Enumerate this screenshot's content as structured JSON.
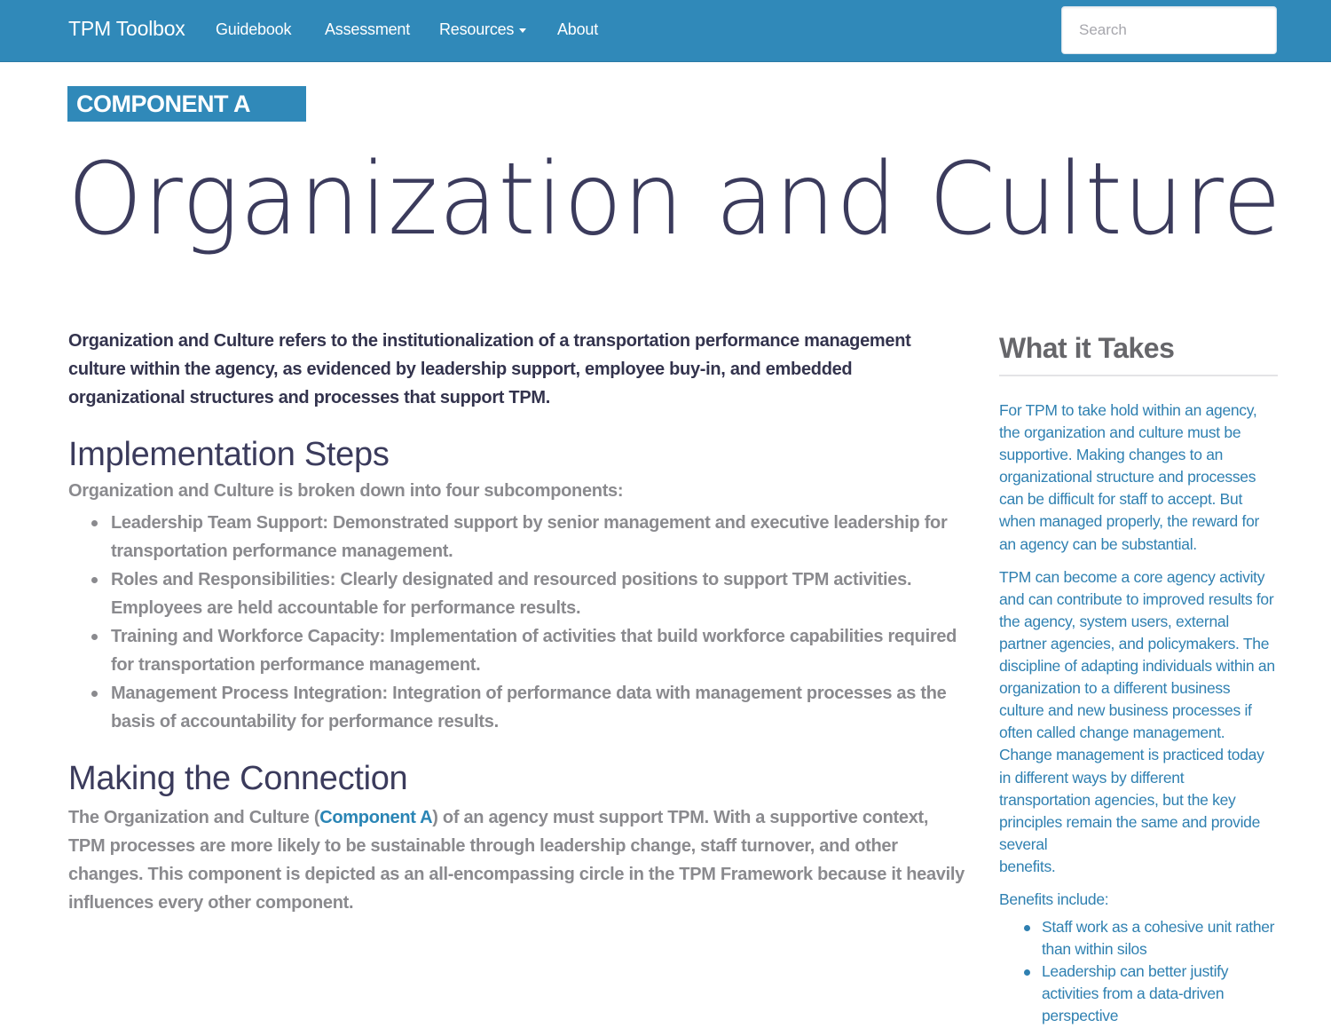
{
  "navbar": {
    "brand": "TPM Toolbox",
    "links": [
      {
        "label": "Guidebook"
      },
      {
        "label": "Assessment"
      },
      {
        "label": "Resources",
        "has_dropdown": true
      },
      {
        "label": "About"
      }
    ],
    "search_placeholder": "Search",
    "search_value": ""
  },
  "header": {
    "component_label": "COMPONENT A",
    "title": "Organization and Culture"
  },
  "main": {
    "intro": "Organization and Culture refers to the institutionalization of a transportation performance management culture within the agency, as evidenced by leadership support, employee buy-in, and embedded organizational structures and processes that support TPM.",
    "implementation": {
      "heading": "Implementation Steps",
      "intro": "Organization and Culture is broken down into four subcomponents:",
      "items": [
        "Leadership Team Support: Demonstrated support by senior management and executive leadership for transportation performance management.",
        "Roles and Responsibilities: Clearly designated and resourced positions to support TPM activities. Employees are held accountable for performance results.",
        "Training and Workforce Capacity: Implementation of activities that build workforce capabilities required for transportation performance management.",
        "Management Process Integration: Integration of performance data with management processes as the basis of accountability for performance results."
      ]
    },
    "connection": {
      "heading": "Making the Connection",
      "text_before": "The Organization and Culture (",
      "link": "Component A",
      "text_after": ") of an agency must support TPM. With a supportive context, TPM processes are more likely to be sustainable through leadership change, staff turnover, and other changes. This component is depicted as an all-encompassing circle in the TPM Framework because it heavily influences every other component."
    }
  },
  "sidebar": {
    "title": "What it Takes",
    "paragraph1": "For TPM to take hold within an agency, the organization and culture must be supportive. Making changes to an organizational structure and processes can be difficult for staff to accept. But when managed properly, the reward for an agency can be substantial.",
    "paragraph2_a": "TPM can become a core agency activity and can contribute to improved results for the agency, system users, external partner agencies, and policymakers. The discipline of adapting individuals within an organization to a different business culture and new business processes if often called change management. Change management is practiced today in different ways by different transportation agencies, but the key principles remain the same and provide several",
    "paragraph2_b": "benefits.",
    "benefits_intro": "Benefits include:",
    "benefits": [
      "Staff work as a cohesive unit rather than within silos",
      "Leadership can better justify activities from a data-driven perspective"
    ]
  },
  "colors": {
    "brand_blue": "#3089b9",
    "heading_navy": "#3b3b5c",
    "muted_gray": "#8a8a8e",
    "sidebar_blue": "#2f80b1"
  }
}
